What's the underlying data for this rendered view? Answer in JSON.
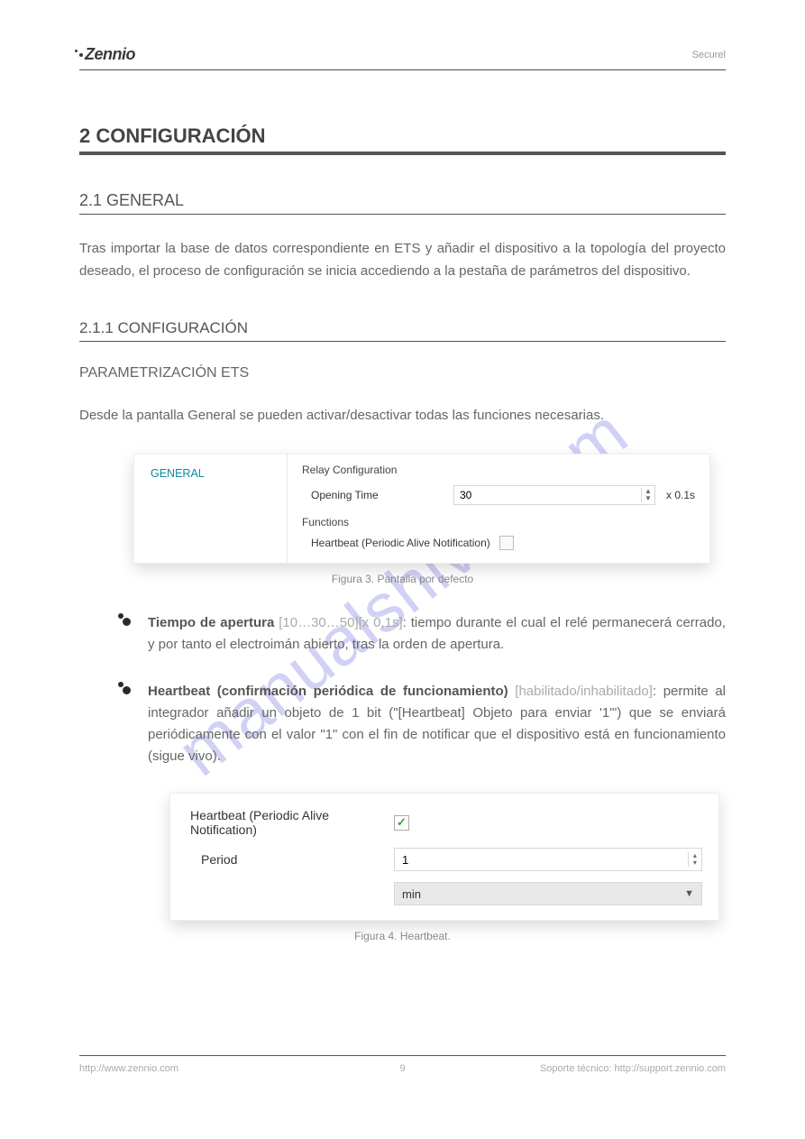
{
  "header": {
    "brand": "Zennio",
    "right": "Securel"
  },
  "watermark": "manualshive.com",
  "sections": {
    "s2": "2 CONFIGURACIÓN",
    "s21": "2.1 GENERAL",
    "s211": "2.1.1  CONFIGURACIÓN"
  },
  "paragraphs": {
    "intro1": "Tras importar la base de datos correspondiente en ETS y añadir el dispositivo a la topología del proyecto deseado, el proceso de configuración se inicia accediendo a la pestaña de parámetros del dispositivo.",
    "subhead": "PARAMETRIZACIÓN ETS",
    "intro2": "Desde la pantalla General se pueden activar/desactivar todas las funciones necesarias."
  },
  "fig3": {
    "sidebar": "GENERAL",
    "relay_title": "Relay Configuration",
    "open_label": "Opening Time",
    "open_value": "30",
    "open_suffix": "x 0.1s",
    "func_title": "Functions",
    "hb_label": "Heartbeat (Periodic Alive Notification)",
    "caption": "Figura 3. Pantalla por defecto"
  },
  "bullets": {
    "b1_label": "Tiempo de apertura",
    "b1_range": "[10…30…50][x 0,1s]",
    "b1_text": ": tiempo durante el cual el relé permanecerá cerrado, y por tanto el electroimán abierto, tras la orden de apertura.",
    "b2_label": "Heartbeat (confirmación periódica de funcionamiento)",
    "b2_range": "[habilitado/inhabilitado]",
    "b2_text": ": permite al integrador añadir un objeto de 1 bit (\"[Heartbeat] Objeto para enviar '1'\") que se enviará periódicamente con el valor \"1\" con el fin de notificar que el dispositivo está en funcionamiento (sigue vivo)."
  },
  "fig4": {
    "hb_label": "Heartbeat (Periodic Alive Notification)",
    "period_label": "Period",
    "period_value": "1",
    "unit_value": "min",
    "caption": "Figura 4. Heartbeat."
  },
  "footer": {
    "left": "http://www.zennio.com",
    "center": "9",
    "right": "Soporte técnico: http://support.zennio.com"
  }
}
